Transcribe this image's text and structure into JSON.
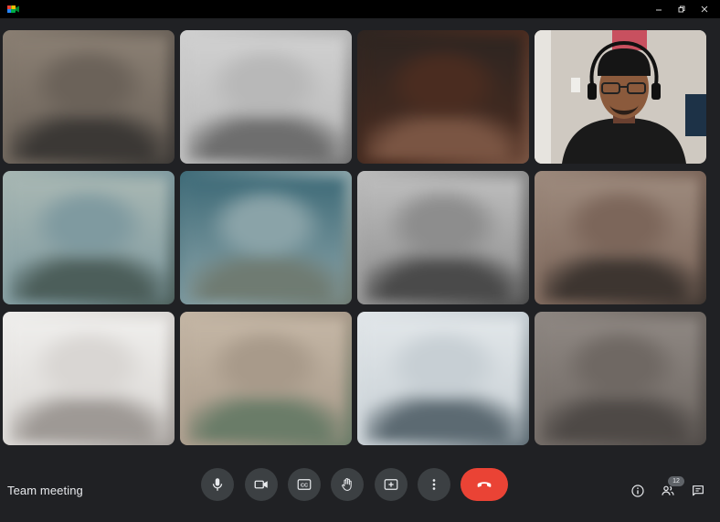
{
  "window": {
    "controls": [
      "minimize-icon",
      "restore-icon",
      "close-icon"
    ]
  },
  "meeting": {
    "title": "Team meeting",
    "participant_count": "12"
  },
  "tiles": [
    {
      "blurred": true,
      "colors": [
        "#6b6259",
        "#3b3835",
        "#8a7f73"
      ]
    },
    {
      "blurred": true,
      "colors": [
        "#b8b8b8",
        "#6e6e6e",
        "#d0d0d0"
      ]
    },
    {
      "blurred": true,
      "colors": [
        "#4a2c20",
        "#7a5543",
        "#2e2521"
      ]
    },
    {
      "blurred": false,
      "colors": [
        "#c9c4bd",
        "#1c1c1c",
        "#8b5a3c"
      ]
    },
    {
      "blurred": true,
      "colors": [
        "#7f9aa0",
        "#4c5e5a",
        "#a8b7b3"
      ]
    },
    {
      "blurred": true,
      "colors": [
        "#8aa3a8",
        "#6f7b72",
        "#3f6b78"
      ]
    },
    {
      "blurred": true,
      "colors": [
        "#8d8d8d",
        "#4a4a4a",
        "#bdbdbd"
      ]
    },
    {
      "blurred": true,
      "colors": [
        "#7c665a",
        "#3d3530",
        "#9d8a7d"
      ]
    },
    {
      "blurred": true,
      "colors": [
        "#d9d6d3",
        "#9e9995",
        "#efeeec"
      ]
    },
    {
      "blurred": true,
      "colors": [
        "#a89a8a",
        "#6a7c68",
        "#c4b6a5"
      ]
    },
    {
      "blurred": true,
      "colors": [
        "#c7cfd4",
        "#5c6a72",
        "#e1e6e9"
      ]
    },
    {
      "blurred": true,
      "colors": [
        "#6f6863",
        "#4e4946",
        "#8e8782"
      ]
    }
  ],
  "controls": {
    "mic": "mic-icon",
    "camera": "camera-icon",
    "captions": "CC",
    "raise_hand": "hand-icon",
    "present": "present-icon",
    "more": "more-vert-icon",
    "hangup": "hangup-icon"
  },
  "side_controls": [
    "info-icon",
    "people-icon",
    "chat-icon"
  ],
  "colors": {
    "background": "#202124",
    "control_bg": "#3c4043",
    "hangup": "#ea4335",
    "text": "#e8eaed"
  }
}
